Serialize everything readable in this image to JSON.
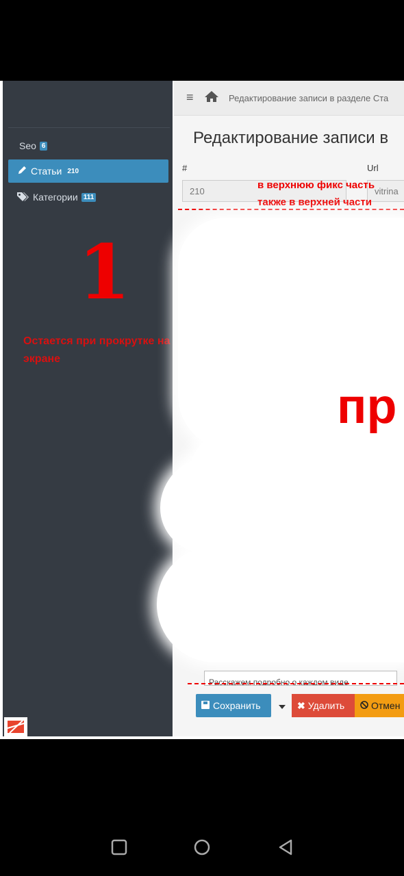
{
  "sidebar": {
    "items": [
      {
        "label": "Seo",
        "badge": "6"
      },
      {
        "label": "Статьи",
        "badge": "210"
      },
      {
        "label": "Категории",
        "badge": "111"
      }
    ],
    "annotation_number": "1",
    "annotation_text": "Остается при прокрутке на экране"
  },
  "topbar": {
    "breadcrumb": "Редактирование записи в разделе Ста"
  },
  "main": {
    "title": "Редактирование записи в",
    "id_label": "#",
    "url_label": "Url",
    "id_value": "210",
    "url_value": "vitrina",
    "annotation_top_line1": "в верхнюю фикс часть",
    "annotation_top_line2": "также в верхней части",
    "annotation_center": "пр",
    "textarea_text": "Расскажем подробно о каждом виде"
  },
  "buttons": {
    "save": "Сохранить",
    "delete": "Удалить",
    "cancel": "Отмен"
  },
  "colors": {
    "sidebar_bg": "#353b43",
    "accent": "#3c8dbc",
    "danger": "#dd4b39",
    "warning": "#f39c12",
    "annotation": "#e00000"
  }
}
